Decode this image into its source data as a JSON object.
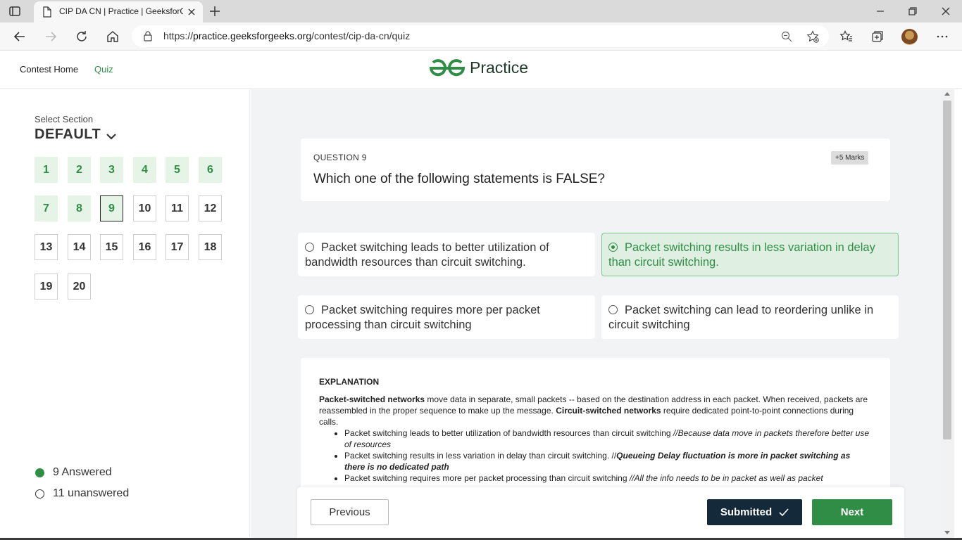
{
  "browser": {
    "tab_title": "CIP DA CN | Practice | GeeksforGeeks",
    "url_prefix": "https://",
    "url_host": "practice.geeksforgeeks.org",
    "url_path": "/contest/cip-da-cn/quiz"
  },
  "header": {
    "nav_home": "Contest Home",
    "nav_quiz": "Quiz",
    "logo_text": "Practice"
  },
  "sidebar": {
    "section_label": "Select Section",
    "section_value": "DEFAULT",
    "questions": [
      "1",
      "2",
      "3",
      "4",
      "5",
      "6",
      "7",
      "8",
      "9",
      "10",
      "11",
      "12",
      "13",
      "14",
      "15",
      "16",
      "17",
      "18",
      "19",
      "20"
    ],
    "answered_label": "9 Answered",
    "unanswered_label": "11 unanswered"
  },
  "question": {
    "number_label": "QUESTION 9",
    "marks": "+5 Marks",
    "text": "Which one of the following statements is FALSE?"
  },
  "options": [
    "Packet switching leads to better utilization of bandwidth resources than circuit switching.",
    "Packet switching results in less variation in delay than circuit switching.",
    "Packet switching requires more per packet processing than circuit switching",
    "Packet switching can lead to reordering unlike in circuit switching"
  ],
  "explanation": {
    "title": "EXPLANATION",
    "p_bold1": "Packet-switched networks",
    "p_text1": " move data in separate, small packets -- based on the destination address in each packet. When received, packets are reassembled in the proper sequence to make up the message. ",
    "p_bold2": "Circuit-switched networks",
    "p_text2": " require dedicated point-to-point connections during calls.",
    "item1_text": "Packet switching leads to better utilization of bandwidth resources than circuit switching ",
    "item1_note": "//Because data move in packets therefore better use of resources",
    "item2_text": "Packet switching results in less variation in delay than circuit switching. //",
    "item2_note": "Queueing Delay fluctuation is more in packet switching as  there is no dedicated path",
    "item3_text": "Packet switching requires more per packet processing than circuit switching  ",
    "item3_note": "//All the info needs to be in packet as well as packet"
  },
  "footer": {
    "previous": "Previous",
    "submitted": "Submitted",
    "next": "Next"
  },
  "colors": {
    "brand_green": "#2f8d46",
    "answered_bg": "#e6f4e8",
    "submitted_bg": "#142a3a"
  }
}
